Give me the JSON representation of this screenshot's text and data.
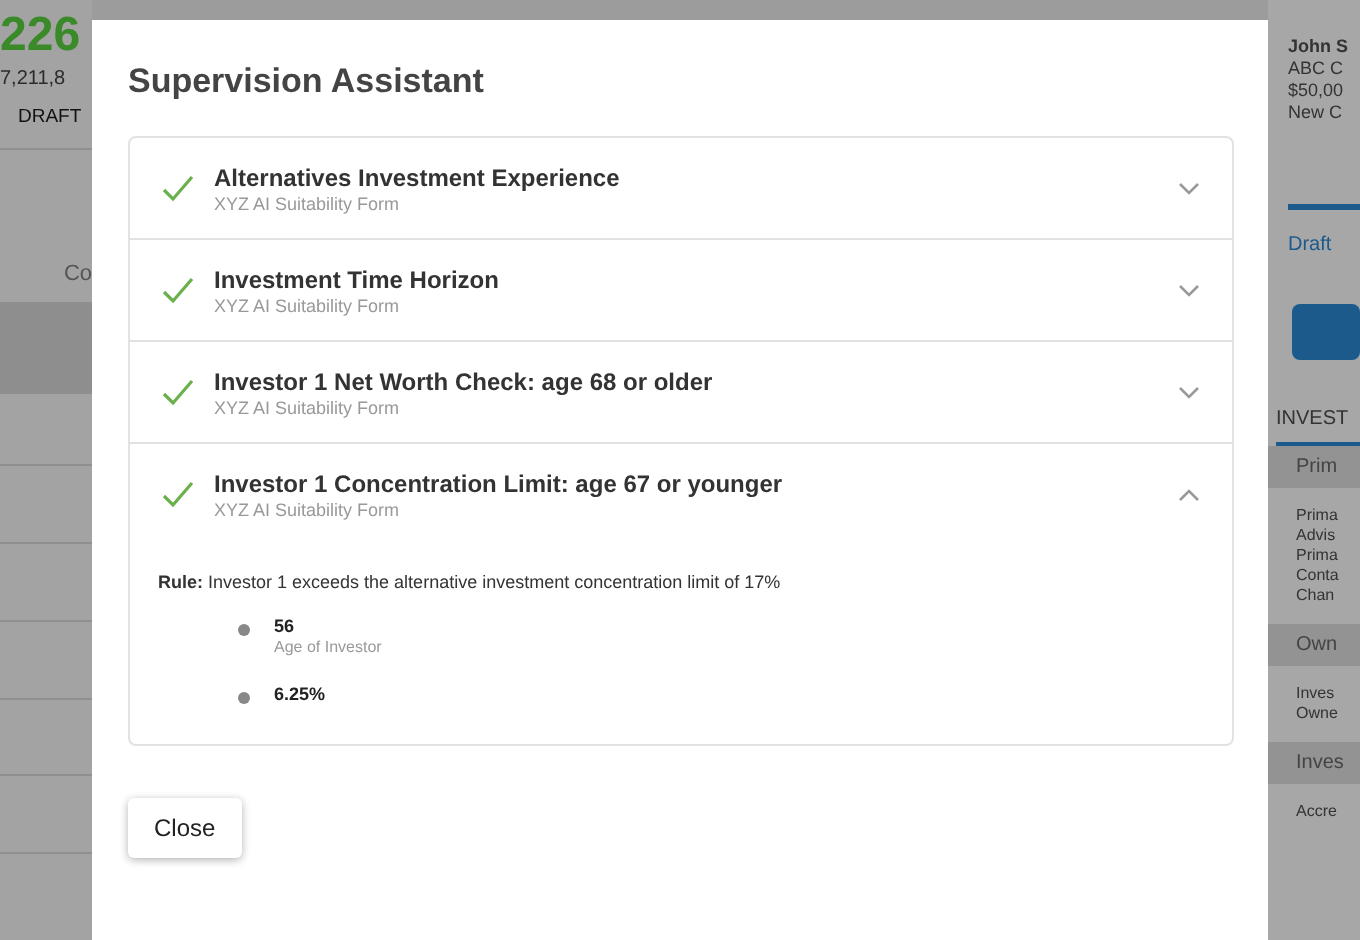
{
  "background_left": {
    "headline": "226",
    "amount": "7,211,8",
    "status": "DRAFT",
    "label": "Co"
  },
  "background_right": {
    "contact": [
      "John S",
      "ABC C",
      "$50,00",
      "New C"
    ],
    "link": "Draft",
    "section": "INVEST",
    "groups": [
      {
        "header": "Prim",
        "lines": [
          "Prima",
          "Advis",
          "Prima",
          "Conta",
          "Chan"
        ]
      },
      {
        "header": "Own",
        "lines": [
          "Inves",
          "Owne"
        ]
      },
      {
        "header": "Inves",
        "lines": [
          "Accre"
        ]
      }
    ]
  },
  "modal": {
    "title": "Supervision Assistant",
    "checks": [
      {
        "title": "Alternatives Investment Experience",
        "source": "XYZ AI Suitability Form",
        "passed": true,
        "expanded": false
      },
      {
        "title": "Investment Time Horizon",
        "source": "XYZ AI Suitability Form",
        "passed": true,
        "expanded": false
      },
      {
        "title": "Investor 1 Net Worth Check: age 68 or older",
        "source": "XYZ AI Suitability Form",
        "passed": true,
        "expanded": false
      },
      {
        "title": "Investor 1 Concentration Limit: age 67 or younger",
        "source": "XYZ AI Suitability Form",
        "passed": true,
        "expanded": true,
        "rule": "**Rule:** Investor 1 exceeds the alternative investment concentration limit of 17%",
        "facts": [
          {
            "value": "56",
            "label": "Age of Investor"
          },
          {
            "value": "6.25%"
          }
        ]
      }
    ],
    "close_button": "Close"
  }
}
